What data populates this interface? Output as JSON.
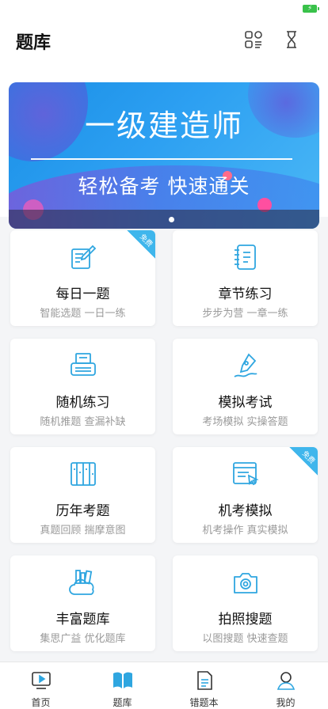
{
  "header": {
    "title": "题库",
    "icons": [
      "grid-list-icon",
      "hourglass-icon"
    ]
  },
  "banner": {
    "title": "一级建造师",
    "subtitle": "轻松备考 快速通关"
  },
  "cards": [
    {
      "title": "每日一题",
      "subtitle": "智能选题 一日一练",
      "icon": "note-pencil-icon",
      "badge": "免费"
    },
    {
      "title": "章节练习",
      "subtitle": "步步为营 一章一练",
      "icon": "notebook-icon",
      "badge": ""
    },
    {
      "title": "随机练习",
      "subtitle": "随机推题 查漏补缺",
      "icon": "printer-icon",
      "badge": ""
    },
    {
      "title": "模拟考试",
      "subtitle": "考场模拟 实操答题",
      "icon": "pen-nib-icon",
      "badge": ""
    },
    {
      "title": "历年考题",
      "subtitle": "真题回顾 揣摩意图",
      "icon": "archive-icon",
      "badge": ""
    },
    {
      "title": "机考模拟",
      "subtitle": "机考操作 真实模拟",
      "icon": "computer-window-icon",
      "badge": "免费"
    },
    {
      "title": "丰富题库",
      "subtitle": "集思广益 优化题库",
      "icon": "cloud-books-icon",
      "badge": ""
    },
    {
      "title": "拍照搜题",
      "subtitle": "以图搜题 快速查题",
      "icon": "camera-icon",
      "badge": ""
    }
  ],
  "tabbar": {
    "items": [
      {
        "label": "首页",
        "icon": "video-play-icon"
      },
      {
        "label": "题库",
        "icon": "open-book-icon",
        "active": true
      },
      {
        "label": "错题本",
        "icon": "document-icon"
      },
      {
        "label": "我的",
        "icon": "user-icon"
      }
    ]
  },
  "colors": {
    "accent": "#3fb6ec",
    "banner_blue": "#1a8fe6",
    "muted_text": "#9a9a9a"
  }
}
